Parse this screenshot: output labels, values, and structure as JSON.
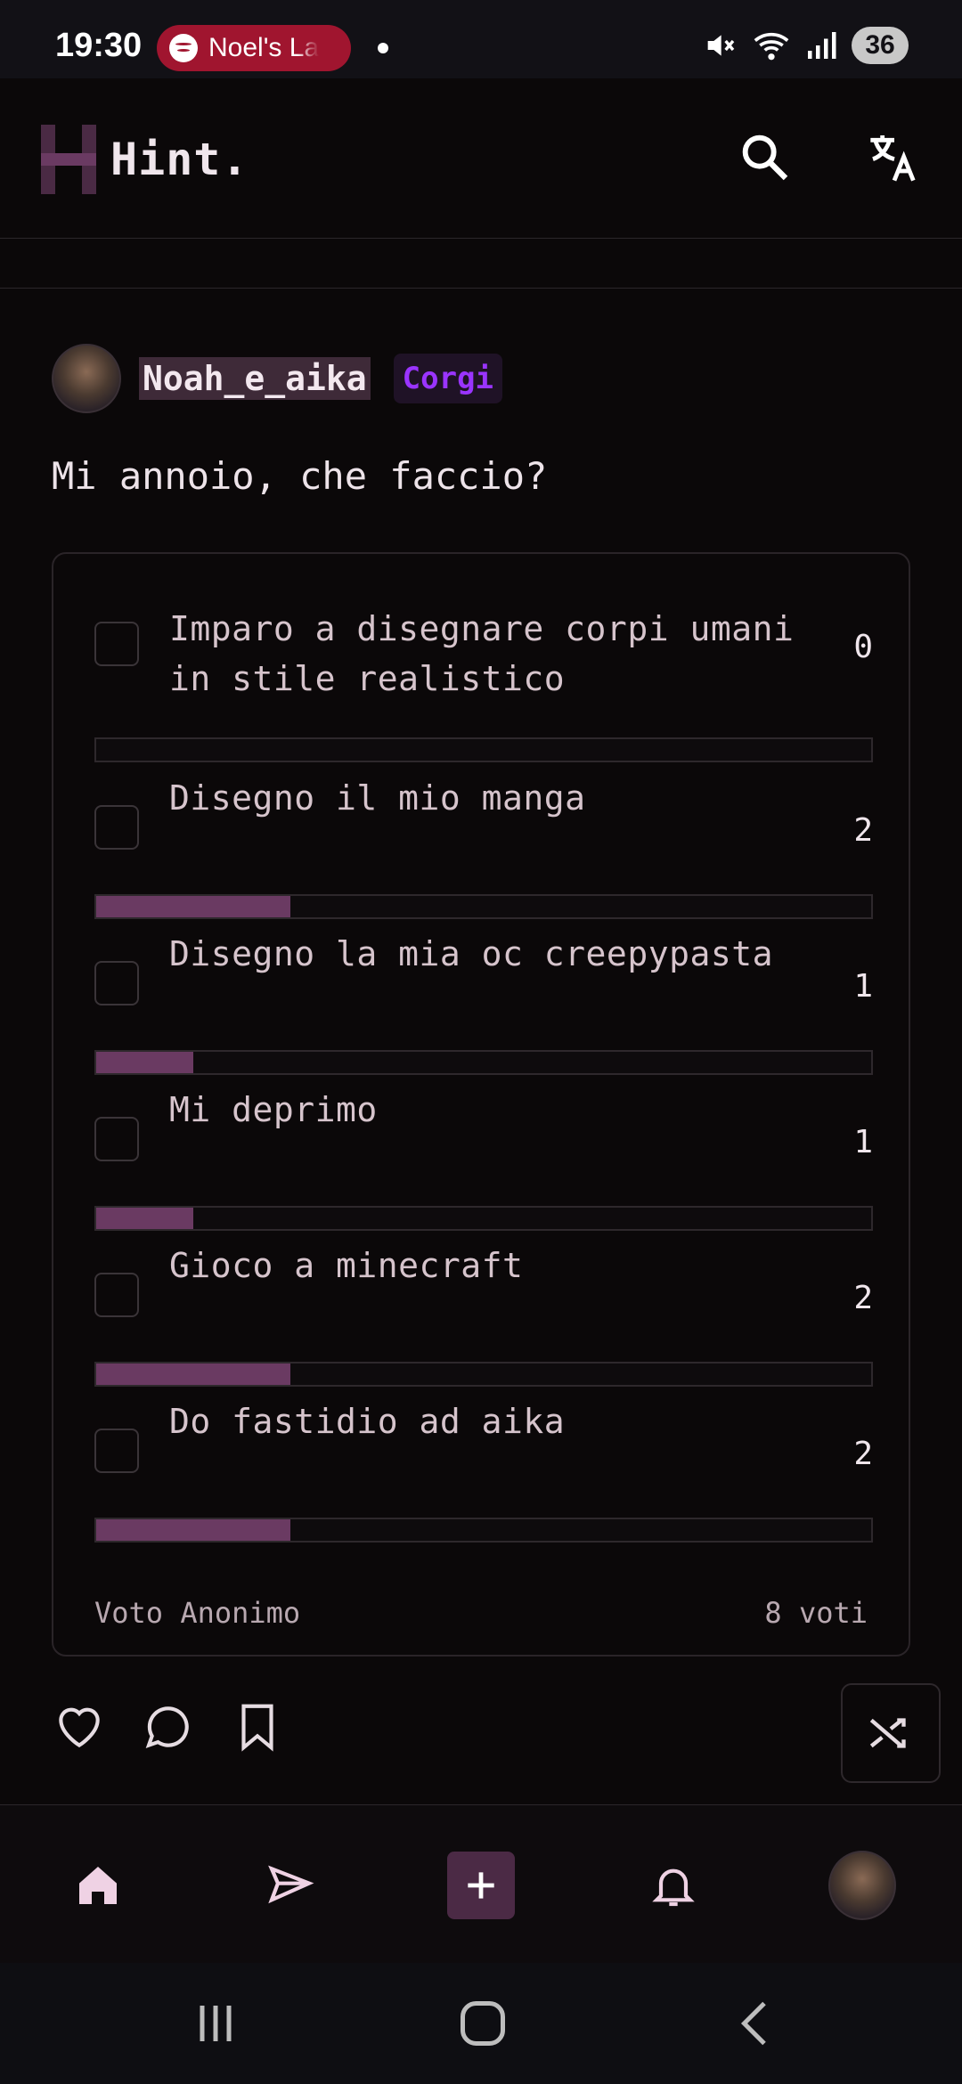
{
  "status_bar": {
    "time": "19:30",
    "media_pill_label": "Noel's La",
    "battery": "36",
    "icons": [
      "mute-icon",
      "wifi-icon",
      "signal-icon",
      "battery-icon"
    ]
  },
  "header": {
    "app_name": "Hint.",
    "icons": [
      "search-icon",
      "translate-icon"
    ]
  },
  "post": {
    "username": "Noah_e_aika",
    "tag": "Corgi",
    "text": "Mi annoio, che faccio?",
    "poll": {
      "options": [
        {
          "label": "Imparo a disegnare corpi umani in stile realistico",
          "count": "0",
          "fraction": 0.0
        },
        {
          "label": "Disegno il mio manga",
          "count": "2",
          "fraction": 0.25
        },
        {
          "label": "Disegno la mia oc creepypasta",
          "count": "1",
          "fraction": 0.125
        },
        {
          "label": "Mi deprimo",
          "count": "1",
          "fraction": 0.125
        },
        {
          "label": "Gioco a minecraft",
          "count": "2",
          "fraction": 0.25
        },
        {
          "label": "Do fastidio ad aika",
          "count": "2",
          "fraction": 0.25
        }
      ],
      "mode": "Voto Anonimo",
      "total": "8 voti"
    },
    "actions": [
      "heart-icon",
      "comment-icon",
      "bookmark-icon",
      "shuffle-icon"
    ]
  },
  "bottom_nav": [
    "home-icon",
    "send-icon",
    "add-icon",
    "bell-icon",
    "profile-avatar"
  ],
  "colors": {
    "background": "#0b0809",
    "accent": "#6a3a62",
    "tag_text": "#9a34ff",
    "username_bg": "#3e2a38"
  }
}
